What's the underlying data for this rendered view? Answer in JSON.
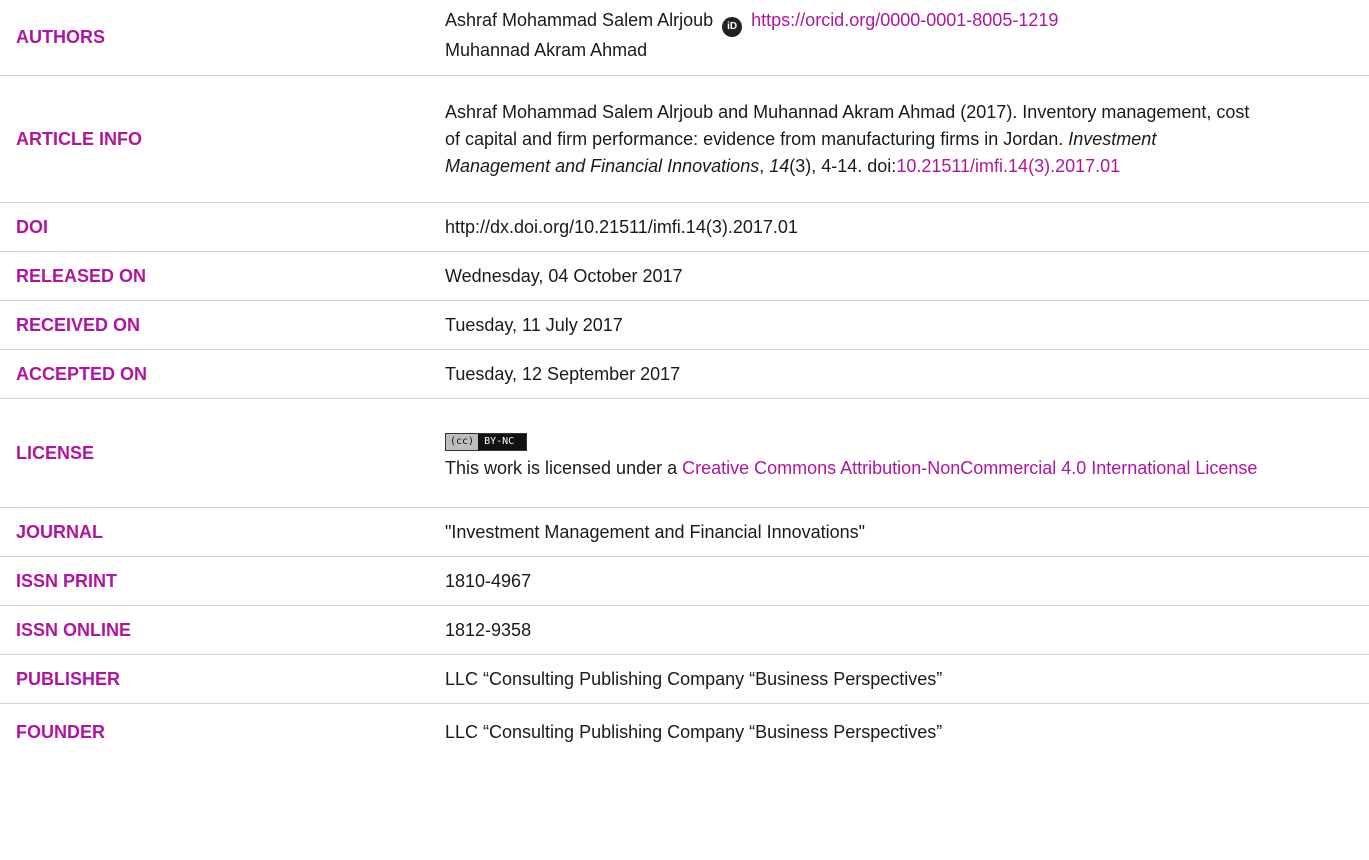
{
  "rows": {
    "authors": {
      "label": "AUTHORS",
      "author1": "Ashraf Mohammad Salem Alrjoub",
      "orcid_url": "https://orcid.org/0000-0001-8005-1219",
      "author2": "Muhannad Akram Ahmad",
      "orcid_icon": "orcid-icon"
    },
    "article_info": {
      "label": "ARTICLE INFO",
      "text_before": "Ashraf Mohammad Salem Alrjoub and Muhannad Akram Ahmad (2017). Inventory management, cost of capital and firm performance: evidence from manufacturing firms in Jordan. ",
      "journal_italic": "Investment Management and Financial Innovations",
      "comma": ", ",
      "volume_italic": "14",
      "issue_pages": "(3), 4-14. doi:",
      "doi_link": "10.21511/imfi.14(3).2017.01"
    },
    "doi": {
      "label": "DOI",
      "value": "http://dx.doi.org/10.21511/imfi.14(3).2017.01"
    },
    "released": {
      "label": "RELEASED ON",
      "value": "Wednesday, 04 October 2017"
    },
    "received": {
      "label": "RECEIVED ON",
      "value": "Tuesday, 11 July 2017"
    },
    "accepted": {
      "label": "ACCEPTED ON",
      "value": "Tuesday, 12 September 2017"
    },
    "license": {
      "label": "LICENSE",
      "badge_cc": "(cc)",
      "badge_by": "BY-NC",
      "text_before": "This work is licensed under a ",
      "link": "Creative Commons Attribution-NonCommercial 4.0 International License"
    },
    "journal": {
      "label": "JOURNAL",
      "value": "\"Investment Management and Financial Innovations\""
    },
    "issn_print": {
      "label": "ISSN PRINT",
      "value": "1810-4967"
    },
    "issn_online": {
      "label": "ISSN ONLINE",
      "value": "1812-9358"
    },
    "publisher": {
      "label": "PUBLISHER",
      "value": "LLC “Consulting Publishing Company “Business Perspectives”"
    },
    "founder": {
      "label": "FOUNDER",
      "value": "LLC “Consulting Publishing Company “Business Perspectives”"
    }
  },
  "colors": {
    "accent": "#b0159f",
    "text": "#1a1a1a",
    "divider": "#d4d4d4"
  }
}
